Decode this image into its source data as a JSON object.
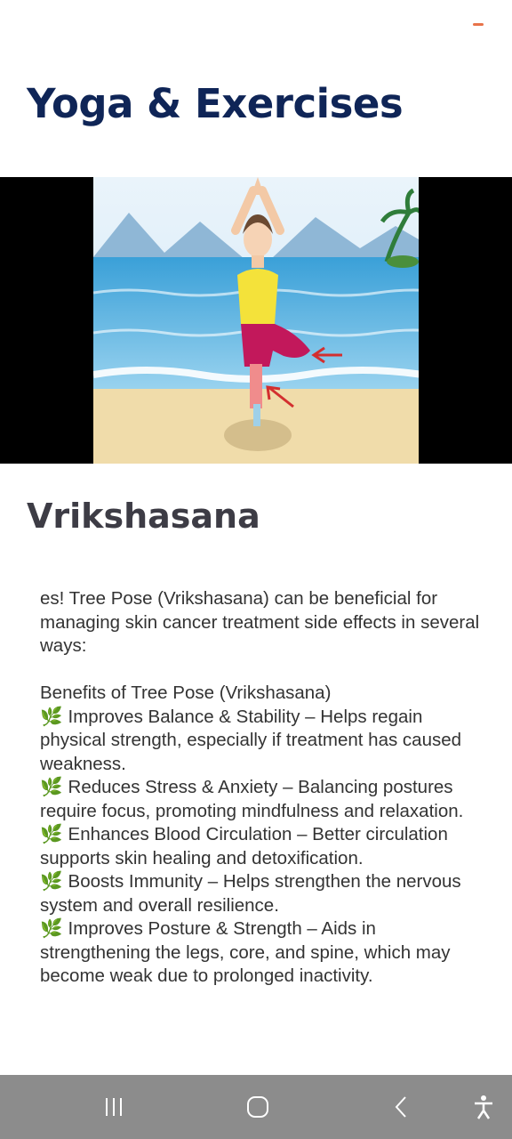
{
  "header": {
    "title": "Yoga & Exercises"
  },
  "pose": {
    "name": "Vrikshasana"
  },
  "description": {
    "intro": "es! Tree Pose (Vrikshasana) can be beneficial for managing skin cancer treatment side effects in several ways:",
    "benefits_heading": "Benefits of Tree Pose (Vrikshasana)",
    "benefits": [
      {
        "icon": "🌿",
        "text": "Improves Balance & Stability – Helps regain physical strength, especially if treatment has caused weakness."
      },
      {
        "icon": "🌿",
        "text": "Reduces Stress & Anxiety – Balancing postures require focus, promoting mindfulness and relaxation."
      },
      {
        "icon": "🌿",
        "text": "Enhances Blood Circulation – Better circulation supports skin healing and detoxification."
      },
      {
        "icon": "🌿",
        "text": "Boosts Immunity – Helps strengthen the nervous system and overall resilience."
      },
      {
        "icon": "🌿",
        "text": "Improves Posture & Strength – Aids in strengthening the legs, core, and spine, which may become weak due to prolonged inactivity."
      }
    ]
  },
  "navbar": {
    "icons": [
      "recent-apps-icon",
      "home-icon",
      "back-icon",
      "accessibility-icon"
    ],
    "color": "#8c8c8c"
  },
  "colors": {
    "title": "#0f2557",
    "accent": "#e8734a"
  }
}
